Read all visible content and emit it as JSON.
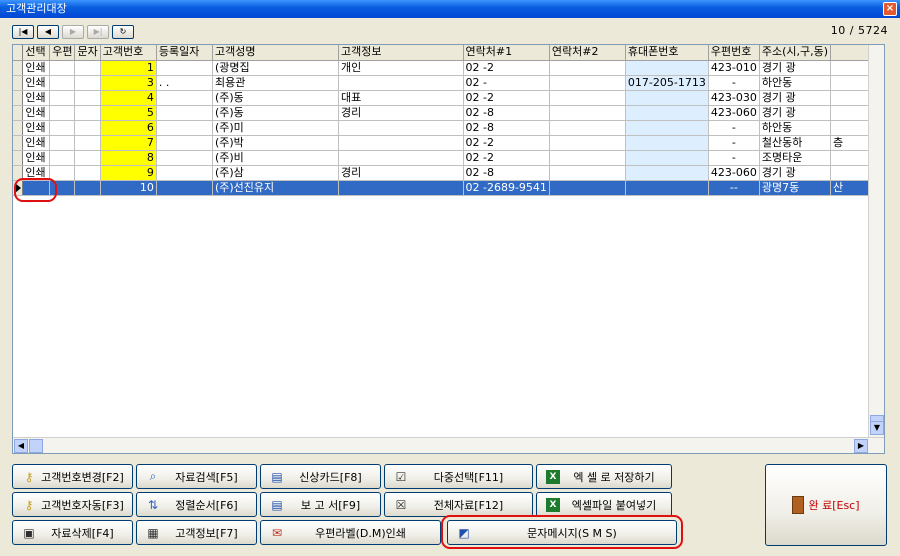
{
  "window": {
    "title": "고객관리대장",
    "close_label": "×"
  },
  "nav": {
    "first": "|◀",
    "prev": "◀",
    "next": "▶",
    "last": "▶|",
    "refresh": "↻"
  },
  "record_count": "10 / 5724",
  "grid": {
    "columns": [
      "선택",
      "우편",
      "문자",
      "고객번호",
      "등록일자",
      "고객성명",
      "고객정보",
      "연락처#1",
      "연락처#2",
      "휴대폰번호",
      "우편번호",
      "주소(시,구,동)"
    ],
    "rows": [
      [
        "인쇄",
        "",
        "",
        "1",
        "",
        "(광명집",
        "개인",
        "02   -2",
        "",
        "",
        "423-010",
        "경기 광",
        ""
      ],
      [
        "인쇄",
        "",
        "",
        "3",
        "  .    .",
        "최용관",
        "",
        "02   -",
        "",
        "017-205-1713",
        "-",
        "하안동",
        ""
      ],
      [
        "인쇄",
        "",
        "",
        "4",
        "",
        "(주)동",
        "대표",
        "02   -2",
        "",
        "",
        "423-030",
        "경기 광",
        ""
      ],
      [
        "인쇄",
        "",
        "",
        "5",
        "",
        "(주)동",
        "경리",
        "02   -8",
        "",
        "",
        "423-060",
        "경기 광",
        ""
      ],
      [
        "인쇄",
        "",
        "",
        "6",
        "",
        "(주)미",
        "",
        "02   -8",
        "",
        "",
        "-",
        "하안동",
        ""
      ],
      [
        "인쇄",
        "",
        "",
        "7",
        "",
        "(주)박",
        "",
        "02   -2",
        "",
        "",
        "-",
        "철산동하",
        "층"
      ],
      [
        "인쇄",
        "",
        "",
        "8",
        "",
        "(주)비",
        "",
        "02   -2",
        "",
        "",
        "-",
        "조명타운",
        ""
      ],
      [
        "인쇄",
        "",
        "",
        "9",
        "",
        "(주)삼",
        "경리",
        "02   -8",
        "",
        "",
        "423-060",
        "경기 광",
        ""
      ],
      [
        "",
        "",
        "",
        "10",
        "",
        "(주)선진유지",
        "",
        "02   -2689-9541",
        "",
        "",
        "--",
        "광명7동",
        "산"
      ]
    ]
  },
  "buttons": {
    "change_no": "고객번호변경[F2]",
    "search": "자료검색[F5]",
    "credit_card": "신상카드[F8]",
    "multi_select": "다중선택[F11]",
    "save_excel": "엑 셀 로 저장하기",
    "auto_no": "고객번호자동[F3]",
    "sort": "정렬순서[F6]",
    "report": "보 고 서[F9]",
    "all_data": "전체자료[F12]",
    "paste_excel": "엑셀파일 붙여넣기",
    "delete": "자료삭제[F4]",
    "info": "고객정보[F7]",
    "label_print": "우편라벨(D.M)인쇄",
    "sms": "문자메시지(S M S)",
    "ok": "완 료[Esc]",
    "excel_icon": "X"
  },
  "accent": {
    "selection": "#316ac5",
    "number_bg": "#ffff00",
    "phone_bg": "#ddeeff",
    "annotation": "#e01010"
  }
}
